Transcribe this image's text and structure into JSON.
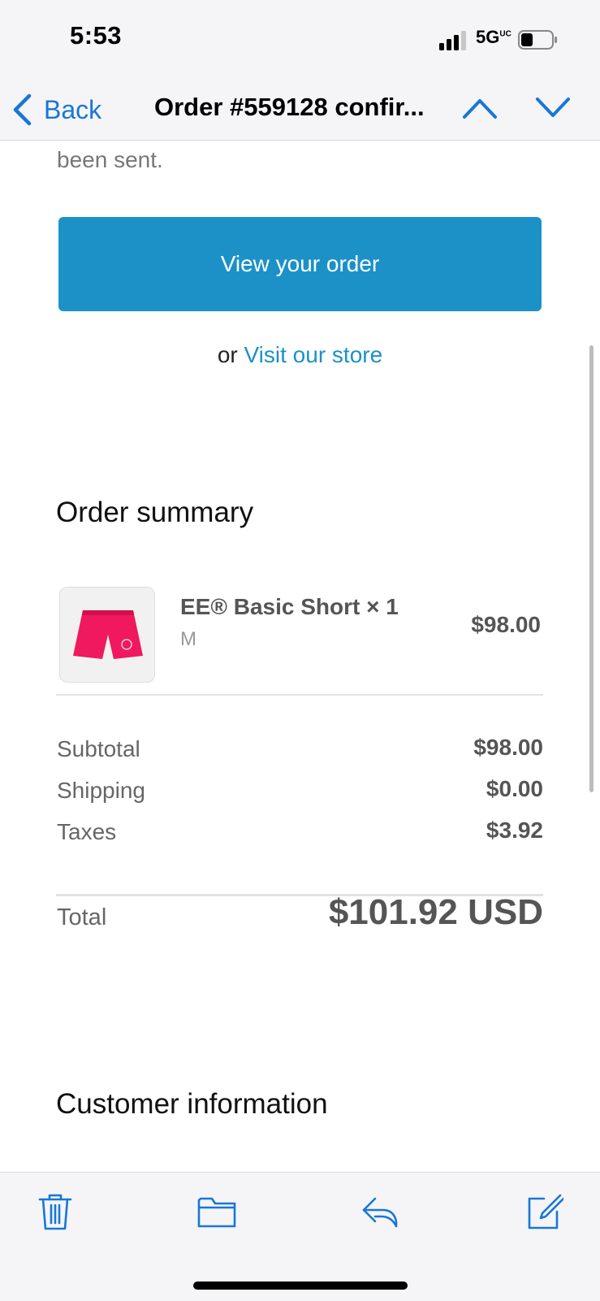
{
  "status_bar": {
    "time": "5:53",
    "network": "5G",
    "network_sup": "UC",
    "battery_icon": "battery-icon",
    "signal_icon": "signal-icon"
  },
  "nav": {
    "back_label": "Back",
    "title": "Order #559128 confir...",
    "accent_color": "#1877d6",
    "icons": [
      "chevron-left-icon",
      "chevron-up-icon",
      "chevron-down-icon"
    ]
  },
  "email": {
    "intro_tail": "been sent.",
    "view_order_button": "View your order",
    "or_text": "or",
    "visit_store_link": "Visit our store",
    "button_color": "#1b91c8",
    "order_summary_title": "Order summary",
    "line_items": [
      {
        "name": "EE® Basic Short × 1",
        "variant": "M",
        "price": "$98.00",
        "thumbnail_icon": "pink-shorts-image"
      }
    ],
    "summary_rows": [
      {
        "label": "Subtotal",
        "value": "$98.00"
      },
      {
        "label": "Shipping",
        "value": "$0.00"
      },
      {
        "label": "Taxes",
        "value": "$3.92"
      }
    ],
    "total_label": "Total",
    "total_value": "$101.92 USD",
    "customer_info_title": "Customer information"
  },
  "toolbar": {
    "icons": [
      "trash-icon",
      "folder-icon",
      "reply-icon",
      "compose-icon"
    ]
  }
}
